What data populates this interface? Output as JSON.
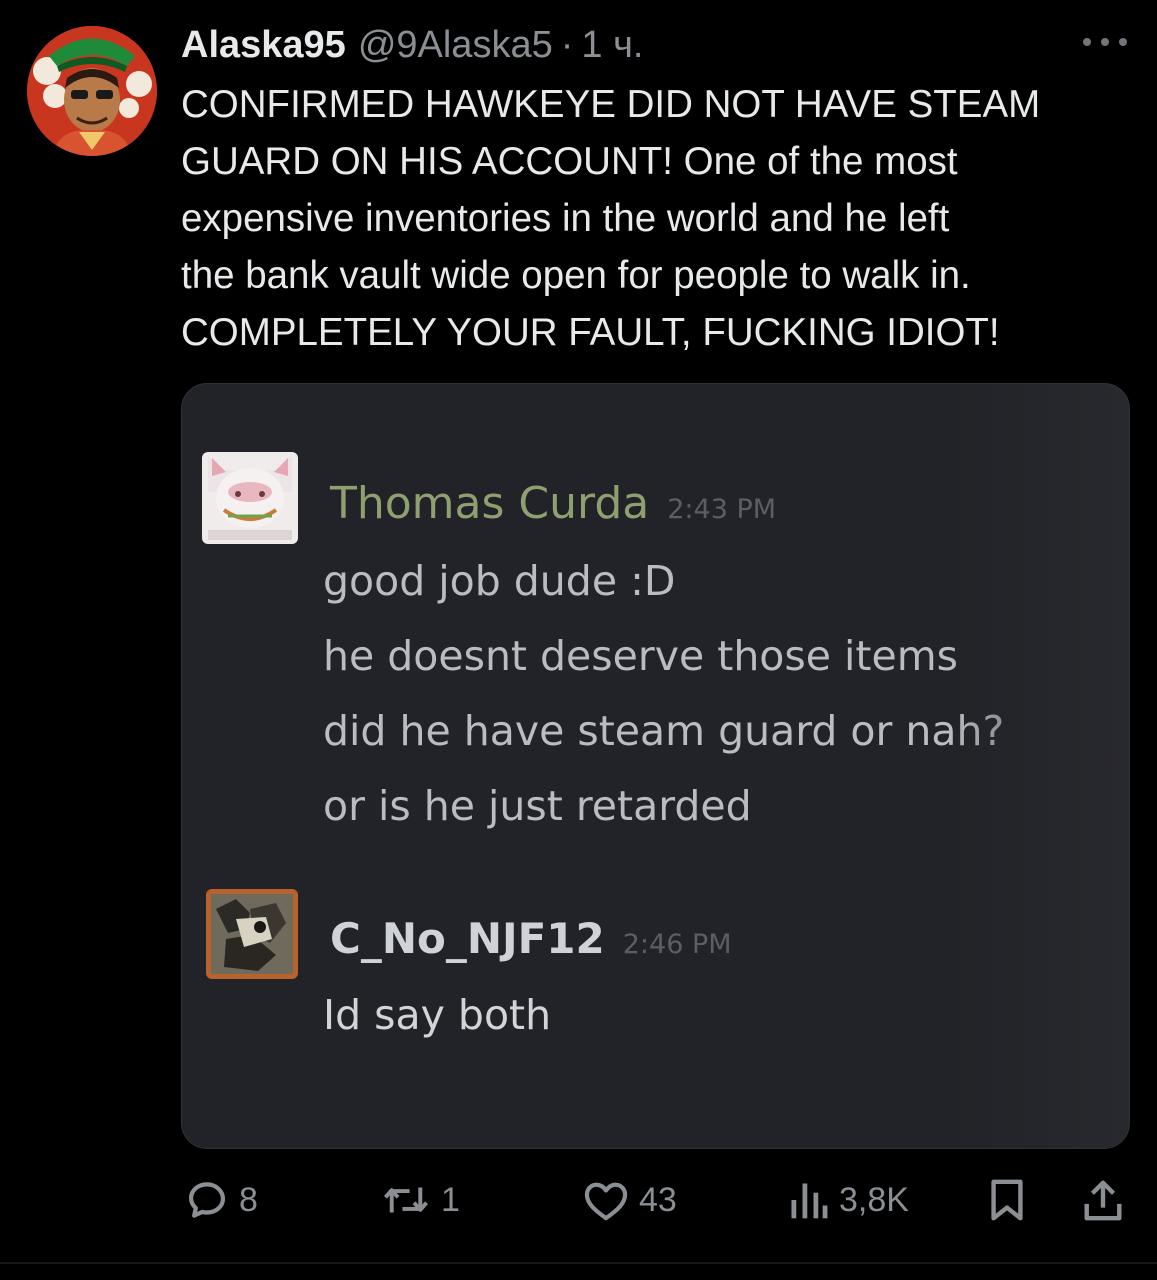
{
  "post": {
    "display_name": "Alaska95",
    "handle": "@9Alaska5",
    "separator": "·",
    "time": "1 ч.",
    "text_lines": [
      "CONFIRMED HAWKEYE DID NOT HAVE STEAM",
      "GUARD ON HIS ACCOUNT! One of the most",
      "expensive inventories in the world and he left",
      "the bank vault wide open for people to walk in.",
      "COMPLETELY YOUR FAULT, FUCKING IDIOT!"
    ]
  },
  "screenshot": {
    "message1": {
      "author": "Thomas Curda",
      "time": "2:43 PM",
      "lines": [
        "good job dude :D",
        "he doesnt deserve those items",
        "did he have steam guard or nah?",
        "or is he just retarded"
      ]
    },
    "message2": {
      "author": "C_No_NJF12",
      "time": "2:46 PM",
      "lines": [
        "Id say both"
      ]
    }
  },
  "actions": {
    "replies": "8",
    "reposts": "1",
    "likes": "43",
    "views": "3,8K"
  },
  "icons": {
    "more": "more-dots-icon",
    "reply": "reply-bubble-icon",
    "repost": "repost-arrows-icon",
    "like": "heart-icon",
    "views": "views-bars-icon",
    "bookmark": "bookmark-icon",
    "share": "share-upload-icon"
  },
  "colors": {
    "background": "#000000",
    "text": "#e7e9ea",
    "secondary": "#8b8f94",
    "author1": "#8ea070"
  }
}
